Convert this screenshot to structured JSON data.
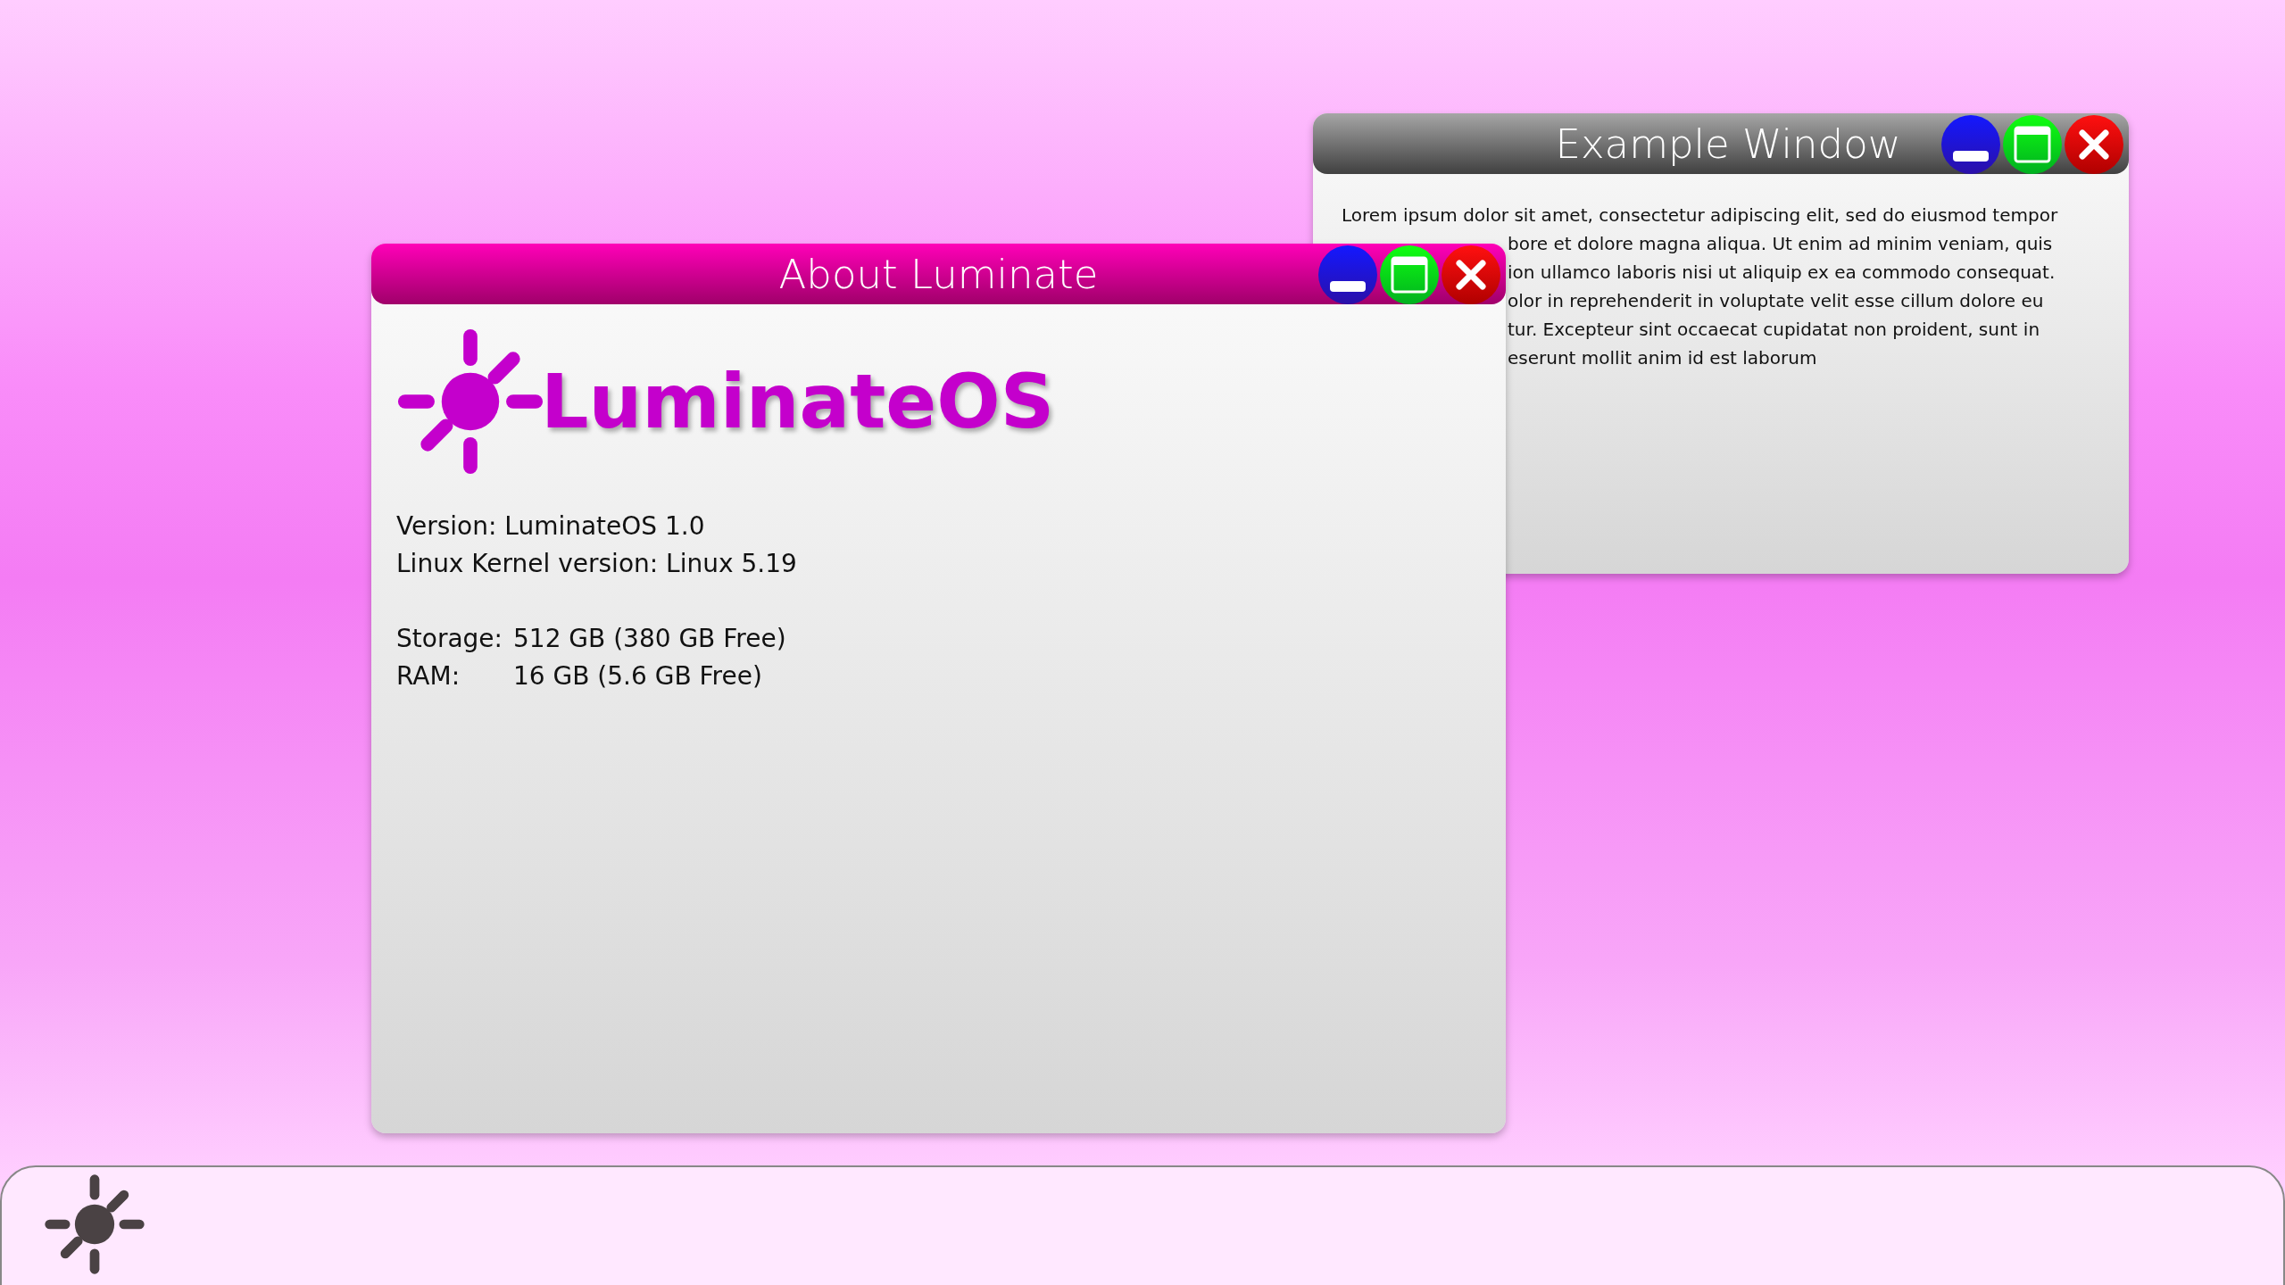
{
  "example_window": {
    "title": "Example Window",
    "lines": [
      {
        "text": "Lorem ipsum dolor sit amet, consectetur adipiscing elit, sed do eiusmod tempor",
        "covered": false
      },
      {
        "text": "bore et dolore magna aliqua. Ut enim ad minim veniam, quis",
        "covered": true
      },
      {
        "text": "ion ullamco laboris nisi ut aliquip ex ea commodo consequat.",
        "covered": true
      },
      {
        "text": "olor in reprehenderit in voluptate velit esse cillum dolore eu",
        "covered": true
      },
      {
        "text": "tur. Excepteur sint occaecat cupidatat non proident, sunt in",
        "covered": true
      },
      {
        "text": "eserunt mollit anim id est laborum",
        "covered": true
      }
    ]
  },
  "about_window": {
    "title": "About Luminate",
    "logo_text": "LuminateOS",
    "info_groups": [
      {
        "aligned": false,
        "rows": [
          {
            "label": "Version:",
            "value": "LuminateOS 1.0"
          },
          {
            "label": "Linux Kernel version:",
            "value": "Linux 5.19"
          }
        ]
      },
      {
        "aligned": true,
        "rows": [
          {
            "label": "Storage:",
            "value": "512 GB (380 GB Free)"
          },
          {
            "label": "RAM:",
            "value": "16 GB (5.6 GB Free)"
          }
        ]
      }
    ]
  }
}
